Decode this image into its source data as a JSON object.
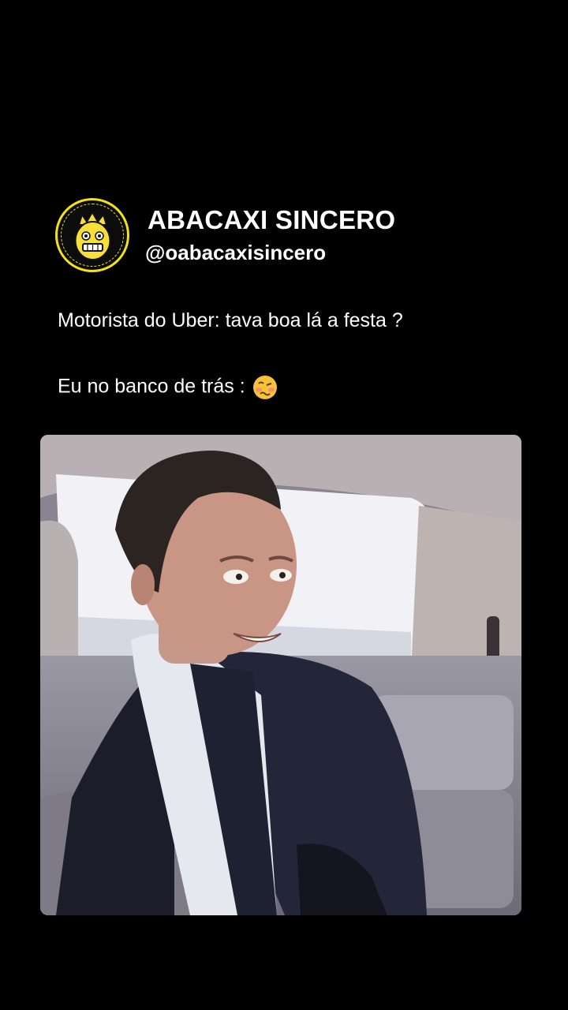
{
  "account": {
    "name": "ABACAXI SINCERO",
    "handle": "@oabacaxisincero",
    "avatar_icon": "pineapple-face-icon",
    "accent_color": "#f2e21a"
  },
  "post": {
    "line1": "Motorista do Uber: tava boa lá a festa ?",
    "line2": "Eu no banco de trás :",
    "emoji": "woozy-face-icon"
  },
  "media": {
    "type": "video-still",
    "scene": "man-in-car-backseat"
  }
}
